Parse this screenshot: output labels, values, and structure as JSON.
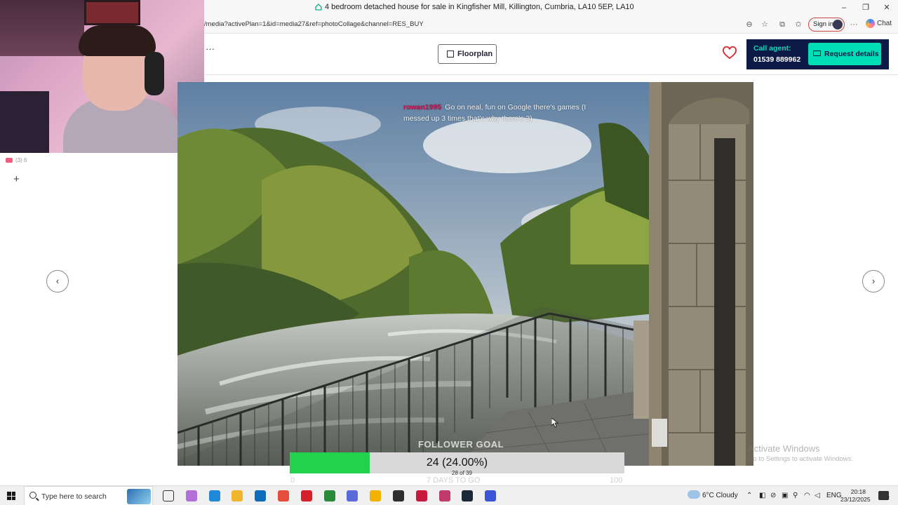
{
  "browser": {
    "window_title": "4 bedroom detached house for sale in Kingfisher Mill, Killington, Cumbria, LA10 5EP, LA10",
    "url": "/media?activePlan=1&id=media27&ref=photoCollage&channel=RES_BUY",
    "sign_in_label": "Sign in",
    "chat_label": "Chat",
    "minimize_glyph": "–",
    "restore_glyph": "❐",
    "close_glyph": "✕"
  },
  "page": {
    "more_glyph": "···",
    "floorplan_label": "Floorplan",
    "call_agent_label": "Call agent:",
    "phone_number": "01539 889962",
    "request_details_label": "Request details",
    "prev_glyph": "‹",
    "next_glyph": "›",
    "brand_accent": "#00deb6",
    "brand_navy": "#0e1a46",
    "favourite_color": "#d9262e"
  },
  "sidebar": {
    "tab_count_label": "(3) 6",
    "add_glyph": "+"
  },
  "stream_overlay": {
    "chat_username": "rowan1995",
    "chat_message": "Go on neal, fun on Google there's games (I messed up 3 times that's why there's 3)",
    "goal_title": "FOLLOWER GOAL",
    "goal_value": "24 (24.00%)",
    "goal_fraction": 0.24,
    "goal_subtext": "28 of 39",
    "goal_min": "0",
    "goal_days_left": "7 DAYS TO GO",
    "goal_max": "100",
    "goal_color": "#22d24e"
  },
  "watermark": {
    "line1": "Activate Windows",
    "line2": "Go to Settings to activate Windows."
  },
  "taskbar": {
    "search_placeholder": "Type here to search",
    "weather": "6°C  Cloudy",
    "language": "ENG",
    "time": "20:18",
    "date": "23/12/2025",
    "notification_count": "2",
    "app_icons": [
      "task-view-icon",
      "copilot-icon",
      "edge-icon",
      "file-explorer-icon",
      "outlook-icon",
      "chrome-icon",
      "opera-icon",
      "xbox-icon",
      "app-icon",
      "security-icon",
      "obs-icon",
      "tiktok-icon",
      "instagram-icon",
      "steam-icon",
      "app-icon"
    ]
  }
}
